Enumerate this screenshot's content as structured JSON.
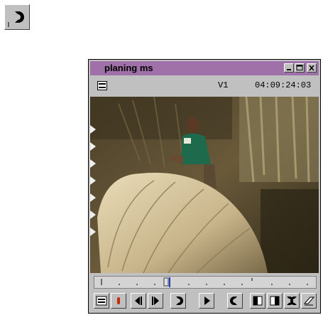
{
  "window": {
    "title": "planing ms",
    "track": "V1",
    "timecode": "04:09:24:03"
  },
  "icons": {
    "standalone": "mark-out-icon",
    "title_buttons": [
      "minimize-icon",
      "maximize-icon",
      "close-icon"
    ],
    "info_menu": "menu-icon",
    "controls": [
      "menu-icon",
      "record-icon",
      "step-back-icon",
      "step-forward-icon",
      "mark-in-icon",
      "play-icon",
      "mark-out-icon",
      "go-to-in-icon",
      "go-to-out-icon",
      "clear-marks-icon",
      "eraser-icon"
    ]
  },
  "colors": {
    "titlebar": "#a070a8",
    "panel": "#c0c0c0",
    "playhead": "#2040c0",
    "record": "#c03000"
  }
}
